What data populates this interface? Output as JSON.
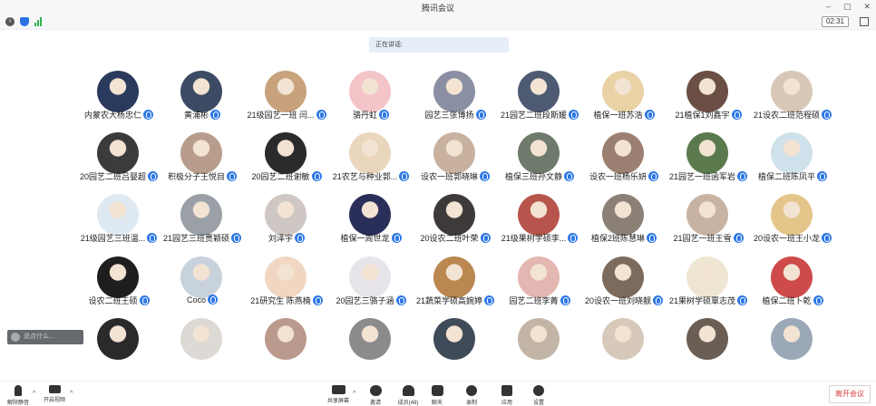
{
  "window": {
    "title": "腾讯会议"
  },
  "status": {
    "timer": "02:31"
  },
  "speaking": {
    "label": "正在讲话:"
  },
  "chat": {
    "placeholder": "说点什么..."
  },
  "participants": [
    {
      "name": "内蒙农大杨忠仁",
      "color": "#2a3a5c"
    },
    {
      "name": "黄浦彬",
      "color": "#3c4b63"
    },
    {
      "name": "21级园艺一班 闫...",
      "color": "#c7a27c"
    },
    {
      "name": "骆丹虹",
      "color": "#f3c4c8"
    },
    {
      "name": "园艺三张博扬",
      "color": "#8a8fa3"
    },
    {
      "name": "21园艺二班段斯媛",
      "color": "#4d5a72"
    },
    {
      "name": "植保一班苏浩",
      "color": "#e8d2a6"
    },
    {
      "name": "21植保1刘鑫宇",
      "color": "#6b4f45"
    },
    {
      "name": "21设农二班范程硕",
      "color": "#d8c7b7"
    },
    {
      "name": "20园艺二班吕婴超",
      "color": "#3b3b3b"
    },
    {
      "name": "积极分子王悦目",
      "color": "#b89c8c"
    },
    {
      "name": "20园艺二班谢敏",
      "color": "#2b2b2b"
    },
    {
      "name": "21农艺与种业郭...",
      "color": "#e9d6bc"
    },
    {
      "name": "设农一班郭晓琳",
      "color": "#c9b1a0"
    },
    {
      "name": "植保三班孙文静",
      "color": "#6e7a6b"
    },
    {
      "name": "设农一班杨乐妍",
      "color": "#9b7f70"
    },
    {
      "name": "21园艺一班函军岩",
      "color": "#5a7a4e"
    },
    {
      "name": "植保二班陈凤平",
      "color": "#cfe1ea"
    },
    {
      "name": "21级园艺三班温...",
      "color": "#dfe9f2"
    },
    {
      "name": "21园艺三班贾颖硕",
      "color": "#9aa0a6"
    },
    {
      "name": "刘泽宇",
      "color": "#cfc7c3"
    },
    {
      "name": "植保一周世龙",
      "color": "#2a2f5a"
    },
    {
      "name": "20设农二班叶荣",
      "color": "#3f3a3a"
    },
    {
      "name": "21级果树学硕李...",
      "color": "#b7554c"
    },
    {
      "name": "植保2班陈慧琳",
      "color": "#8b8076"
    },
    {
      "name": "21园艺一班王雪",
      "color": "#c8b3a2"
    },
    {
      "name": "20设农一班王小龙",
      "color": "#e4c58a"
    },
    {
      "name": "设农二班王硕",
      "color": "#1e1e1e"
    },
    {
      "name": "Coco",
      "color": "#c8d2dc"
    },
    {
      "name": "21研究生 陈燕楠",
      "color": "#f1d7c2"
    },
    {
      "name": "20园艺三骆子涵",
      "color": "#e7e5ea"
    },
    {
      "name": "21蔬菜学硕高婉婷",
      "color": "#b9874f"
    },
    {
      "name": "园艺二班李菁",
      "color": "#e4b6b1"
    },
    {
      "name": "20设农一班刘晓靓",
      "color": "#7c6a5c"
    },
    {
      "name": "21果树学硕覃志茂",
      "color": "#eee6d2"
    },
    {
      "name": "植保二班卜乾",
      "color": "#cf4a4a"
    },
    {
      "name": "",
      "color": "#2a2a2a"
    },
    {
      "name": "",
      "color": "#ddd9d4"
    },
    {
      "name": "",
      "color": "#b99a8c"
    },
    {
      "name": "",
      "color": "#8b8b8b"
    },
    {
      "name": "",
      "color": "#3f4b58"
    },
    {
      "name": "",
      "color": "#c3b5a6"
    },
    {
      "name": "",
      "color": "#d6c9b9"
    },
    {
      "name": "",
      "color": "#6a5e55"
    },
    {
      "name": "",
      "color": "#9ba8b8"
    }
  ],
  "toolbar": {
    "unmute": "解除静音",
    "start_video": "开启视频",
    "share_screen": "共享屏幕",
    "invite": "邀请",
    "members": "成员(48)",
    "chat": "聊天",
    "record": "录制",
    "apps": "应用",
    "settings": "设置",
    "leave": "离开会议"
  }
}
